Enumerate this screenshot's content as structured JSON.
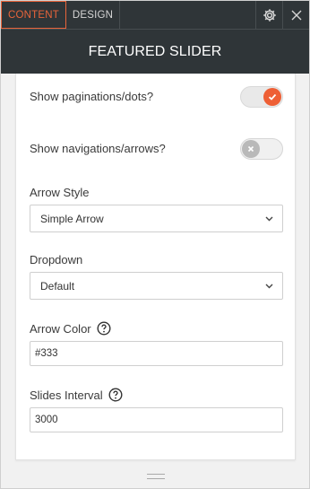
{
  "tabs": [
    {
      "label": "CONTENT",
      "active": true
    },
    {
      "label": "DESIGN",
      "active": false
    }
  ],
  "toolbar_icons": [
    "gear-icon",
    "close-icon"
  ],
  "header": {
    "title": "FEATURED SLIDER"
  },
  "fields": {
    "show_pagination": {
      "label": "Show paginations/dots?",
      "value": true
    },
    "show_navigation": {
      "label": "Show navigations/arrows?",
      "value": false
    },
    "arrow_style": {
      "label": "Arrow Style",
      "value": "Simple Arrow"
    },
    "dropdown": {
      "label": "Dropdown",
      "value": "Default"
    },
    "arrow_color": {
      "label": "Arrow Color",
      "value": "#333"
    },
    "slides_interval": {
      "label": "Slides Interval",
      "value": "3000"
    }
  },
  "colors": {
    "accent": "#e8643a",
    "toggle_on": "#ee5f35",
    "header_bg": "#2f3538"
  }
}
